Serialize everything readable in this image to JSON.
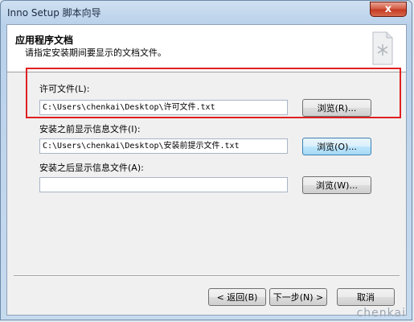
{
  "window": {
    "title": "Inno Setup 脚本向导",
    "close_glyph": "x"
  },
  "header": {
    "title": "应用程序文档",
    "subtitle": "请指定安装期间要显示的文档文件。",
    "icon": "document-icon"
  },
  "fields": [
    {
      "label": "许可文件(L):",
      "value": "C:\\Users\\chenkai\\Desktop\\许可文件.txt",
      "browse": "浏览(R)..."
    },
    {
      "label": "安装之前显示信息文件(I):",
      "value": "C:\\Users\\chenkai\\Desktop\\安装前提示文件.txt",
      "browse": "浏览(O)..."
    },
    {
      "label": "安装之后显示信息文件(A):",
      "value": "",
      "browse": "浏览(W)..."
    }
  ],
  "buttons": {
    "back": "< 返回(B)",
    "next": "下一步(N) >",
    "cancel": "取消"
  },
  "watermark": "chenkai",
  "highlight_color": "#e02020"
}
